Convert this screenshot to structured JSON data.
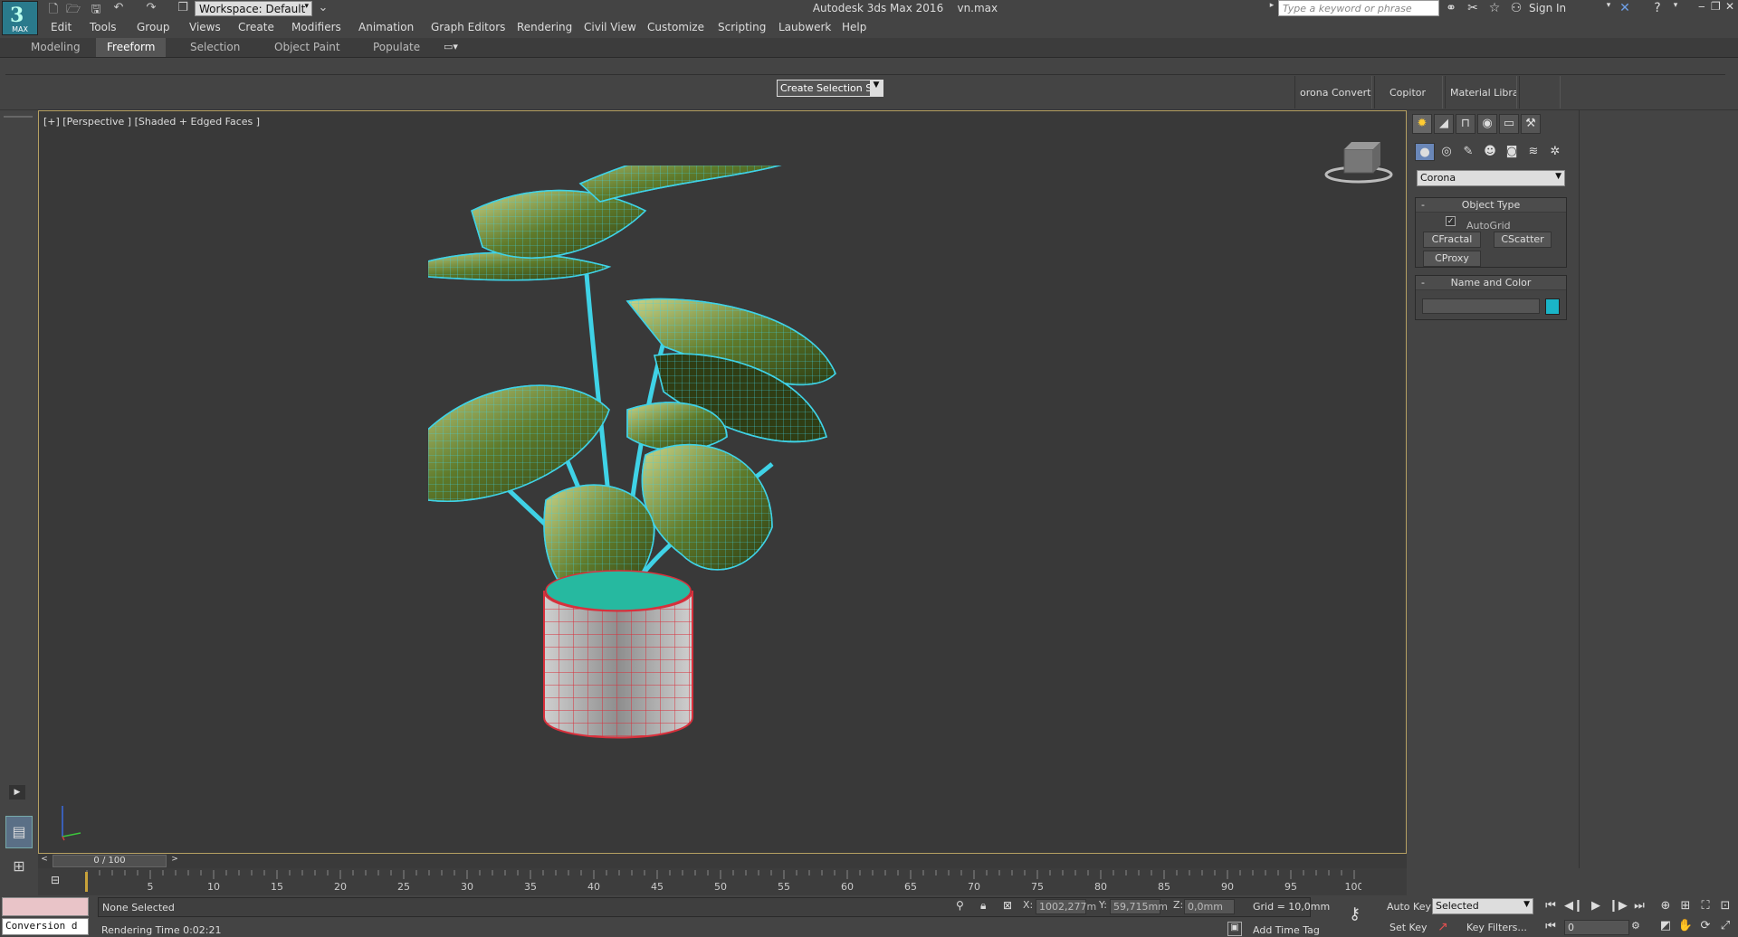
{
  "app": {
    "title": "Autodesk 3ds Max 2016",
    "file": "vn.max",
    "logo_text": "MAX",
    "workspace": "Workspace: Default",
    "search_placeholder": "Type a keyword or phrase",
    "sign_in": "Sign In"
  },
  "menu": [
    "Edit",
    "Tools",
    "Group",
    "Views",
    "Create",
    "Modifiers",
    "Animation",
    "Graph Editors",
    "Rendering",
    "Civil View",
    "Customize",
    "Scripting",
    "Laubwerk",
    "Help"
  ],
  "ribbon": {
    "tabs": [
      "Modeling",
      "Freeform",
      "Selection",
      "Object Paint",
      "Populate"
    ],
    "active_tab": "Freeform",
    "selection_set": "Create Selection Se",
    "buttons": [
      "orona Convert",
      "Copitor",
      "Material Library"
    ]
  },
  "viewport": {
    "label": "[+] [Perspective ] [Shaded + Edged Faces ]",
    "wire_color": "#3fd2e6",
    "pot_wire_color": "#d8303c"
  },
  "command_panel": {
    "renderer": "Corona",
    "rollout_object_type": "Object Type",
    "autogrid_label": "AutoGrid",
    "autogrid_checked": true,
    "buttons": [
      "CFractal",
      "CScatter",
      "CProxy"
    ],
    "rollout_name_color": "Name and Color",
    "object_color": "#1ab5c8"
  },
  "timeline": {
    "frame_display": "0 / 100",
    "ticks": [
      "5",
      "10",
      "15",
      "20",
      "25",
      "30",
      "35",
      "40",
      "45",
      "50",
      "55",
      "60",
      "65",
      "70",
      "75",
      "80",
      "85",
      "90",
      "95",
      "100"
    ]
  },
  "status": {
    "maxscript_listener": "Conversion d",
    "selection": "None Selected",
    "render_time": "Rendering Time  0:02:21",
    "x_label": "X:",
    "x_value": "1002,277m",
    "y_label": "Y:",
    "y_value": "59,715mm",
    "z_label": "Z:",
    "z_value": "0,0mm",
    "grid": "Grid = 10,0mm",
    "add_time_tag": "Add Time Tag",
    "auto_key": "Auto Key",
    "set_key": "Set Key",
    "key_mode": "Selected",
    "key_filters": "Key Filters...",
    "current_frame": "0"
  }
}
